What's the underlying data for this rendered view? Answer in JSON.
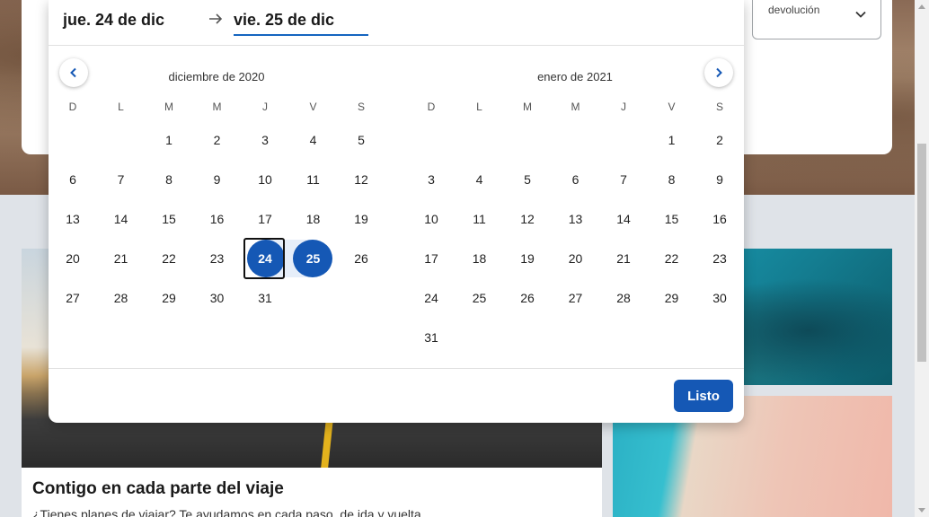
{
  "search": {
    "return_label": "devolución"
  },
  "picker": {
    "start_date": "jue. 24 de dic",
    "end_date": "vie. 25 de dic",
    "done_label": "Listo",
    "weekdays": [
      "D",
      "L",
      "M",
      "M",
      "J",
      "V",
      "S"
    ],
    "months": [
      {
        "title": "diciembre de 2020",
        "weeks": [
          [
            "",
            "",
            "1",
            "2",
            "3",
            "4",
            "5"
          ],
          [
            "6",
            "7",
            "8",
            "9",
            "10",
            "11",
            "12"
          ],
          [
            "13",
            "14",
            "15",
            "16",
            "17",
            "18",
            "19"
          ],
          [
            "20",
            "21",
            "22",
            "23",
            "24",
            "25",
            "26"
          ],
          [
            "27",
            "28",
            "29",
            "30",
            "31",
            "",
            ""
          ]
        ]
      },
      {
        "title": "enero de 2021",
        "weeks": [
          [
            "",
            "",
            "",
            "",
            "",
            "1",
            "2"
          ],
          [
            "3",
            "4",
            "5",
            "6",
            "7",
            "8",
            "9"
          ],
          [
            "10",
            "11",
            "12",
            "13",
            "14",
            "15",
            "16"
          ],
          [
            "17",
            "18",
            "19",
            "20",
            "21",
            "22",
            "23"
          ],
          [
            "24",
            "25",
            "26",
            "27",
            "28",
            "29",
            "30"
          ],
          [
            "31",
            "",
            "",
            "",
            "",
            "",
            ""
          ]
        ]
      }
    ],
    "selected_start": "24",
    "selected_end": "25"
  },
  "promo": {
    "title": "Contigo en cada parte del viaje",
    "description": "¿Tienes planes de viajar? Te ayudamos en cada paso, de ida y vuelta."
  },
  "colors": {
    "accent": "#1558b5",
    "range": "#e6eef9"
  }
}
